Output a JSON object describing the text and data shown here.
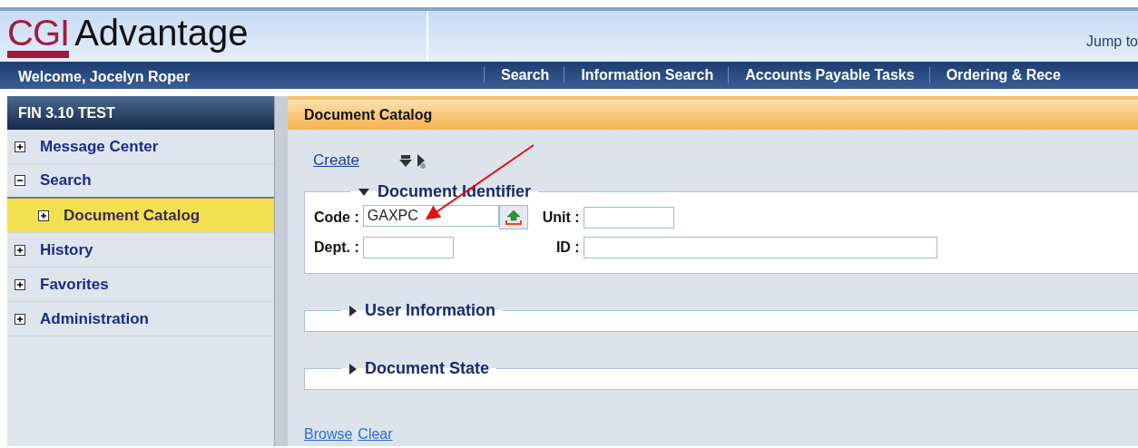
{
  "header": {
    "logo_mark": "CGI",
    "logo_name": "Advantage",
    "jump_label": "Jump to"
  },
  "nav": {
    "welcome": "Welcome, Jocelyn Roper",
    "items": [
      "Search",
      "Information Search",
      "Accounts Payable Tasks",
      "Ordering & Rece"
    ]
  },
  "sidebar": {
    "title": "FIN 3.10 TEST",
    "items": [
      {
        "label": "Message Center",
        "expanded": false,
        "selected": false
      },
      {
        "label": "Search",
        "expanded": true,
        "selected": false,
        "children": [
          {
            "label": "Document Catalog",
            "expanded": false,
            "selected": true
          }
        ]
      },
      {
        "label": "History",
        "expanded": false,
        "selected": false
      },
      {
        "label": "Favorites",
        "expanded": false,
        "selected": false
      },
      {
        "label": "Administration",
        "expanded": false,
        "selected": false
      }
    ]
  },
  "content": {
    "title": "Document Catalog",
    "create": "Create",
    "sections": [
      {
        "title": "Document Identifier",
        "expanded": true,
        "fields": [
          {
            "label": "Code :",
            "value": "GAXPC",
            "lookup": true
          },
          {
            "label": "Unit :",
            "lookup": false
          },
          {
            "label": "Dept. :",
            "lookup": false
          },
          {
            "label": "ID :",
            "lookup": false
          }
        ]
      },
      {
        "title": "User Information",
        "expanded": false
      },
      {
        "title": "Document State",
        "expanded": false
      }
    ],
    "links": [
      "Browse",
      "Clear"
    ]
  }
}
